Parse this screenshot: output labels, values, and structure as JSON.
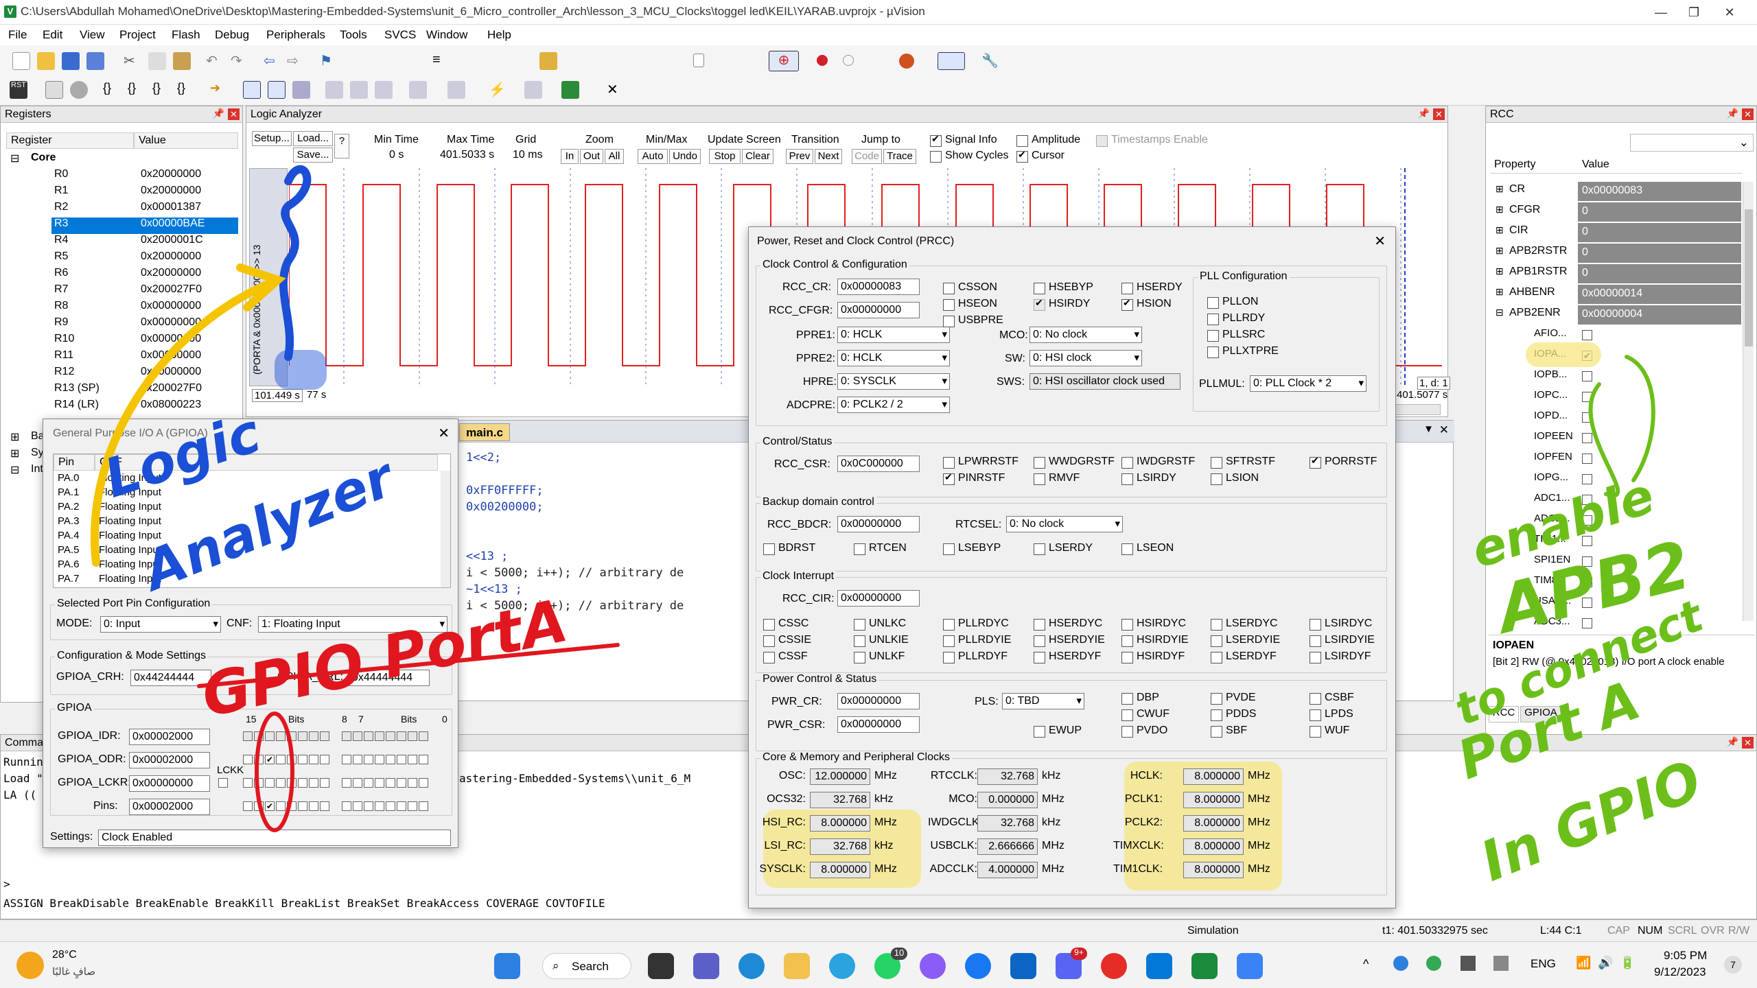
{
  "window": {
    "title": "C:\\Users\\Abdullah Mohamed\\OneDrive\\Desktop\\Mastering-Embedded-Systems\\unit_6_Micro_controller_Arch\\lesson_3_MCU_Clocks\\toggel led\\KEIL\\YARAB.uvprojx - µVision"
  },
  "menu": [
    "File",
    "Edit",
    "View",
    "Project",
    "Flash",
    "Debug",
    "Peripherals",
    "Tools",
    "SVCS",
    "Window",
    "Help"
  ],
  "registers": {
    "title": "Registers",
    "col_register": "Register",
    "col_value": "Value",
    "group": "Core",
    "rows": [
      {
        "name": "R0",
        "value": "0x20000000"
      },
      {
        "name": "R1",
        "value": "0x20000000"
      },
      {
        "name": "R2",
        "value": "0x00001387"
      },
      {
        "name": "R3",
        "value": "0x00000BAE"
      },
      {
        "name": "R4",
        "value": "0x2000001C"
      },
      {
        "name": "R5",
        "value": "0x20000000"
      },
      {
        "name": "R6",
        "value": "0x20000000"
      },
      {
        "name": "R7",
        "value": "0x200027F0"
      },
      {
        "name": "R8",
        "value": "0x00000000"
      },
      {
        "name": "R9",
        "value": "0x00000000"
      },
      {
        "name": "R10",
        "value": "0x00000000"
      },
      {
        "name": "R11",
        "value": "0x00000000"
      },
      {
        "name": "R12",
        "value": "0x00000000"
      },
      {
        "name": "R13 (SP)",
        "value": "0x200027F0"
      },
      {
        "name": "R14 (LR)",
        "value": "0x08000223"
      }
    ],
    "tree_more": [
      "Ba",
      "Sy",
      "Int"
    ]
  },
  "logic_analyzer": {
    "title": "Logic Analyzer",
    "setup": "Setup...",
    "load": "Load...",
    "save": "Save...",
    "help": "?",
    "min_time_label": "Min Time",
    "min_time": "0 s",
    "max_time_label": "Max Time",
    "max_time": "401.5033 s",
    "grid_label": "Grid",
    "grid": "10 ms",
    "zoom_label": "Zoom",
    "zoom_in": "In",
    "zoom_out": "Out",
    "zoom_all": "All",
    "minmax_label": "Min/Max",
    "auto": "Auto",
    "undo": "Undo",
    "update_label": "Update Screen",
    "stop": "Stop",
    "clear": "Clear",
    "transition_label": "Transition",
    "prev": "Prev",
    "next": "Next",
    "jump_label": "Jump to",
    "code": "Code",
    "trace": "Trace",
    "signal_info": "Signal Info",
    "show_cycles": "Show Cycles",
    "amplitude": "Amplitude",
    "cursor": "Cursor",
    "timestamps": "Timestamps Enable",
    "signal_name": "(PORTA & 0x00002000) >> 13",
    "y_high": "1",
    "y_low": "0",
    "t_left": "101.449 s",
    "t_left2": "77 s",
    "t_right": "401.5077 s",
    "t_right2": "4 s",
    "cursor_val": "1, d: 1",
    "pulse_count": 15
  },
  "rcc_panel": {
    "title": "RCC",
    "col_property": "Property",
    "col_value": "Value",
    "rows": [
      {
        "name": "CR",
        "value": "0x00000083"
      },
      {
        "name": "CFGR",
        "value": "0"
      },
      {
        "name": "CIR",
        "value": "0"
      },
      {
        "name": "APB2RSTR",
        "value": "0"
      },
      {
        "name": "APB1RSTR",
        "value": "0"
      },
      {
        "name": "AHBENR",
        "value": "0x00000014"
      },
      {
        "name": "APB2ENR",
        "value": "0x00000004"
      }
    ],
    "bits": [
      {
        "name": "AFIO...",
        "checked": false
      },
      {
        "name": "IOPA...",
        "checked": true
      },
      {
        "name": "IOPB...",
        "checked": false
      },
      {
        "name": "IOPC...",
        "checked": false
      },
      {
        "name": "IOPD...",
        "checked": false
      },
      {
        "name": "IOPEEN",
        "checked": false
      },
      {
        "name": "IOPFEN",
        "checked": false
      },
      {
        "name": "IOPG...",
        "checked": false
      },
      {
        "name": "ADC1...",
        "checked": false
      },
      {
        "name": "ADC2...",
        "checked": false
      },
      {
        "name": "TIM1...",
        "checked": false
      },
      {
        "name": "SPI1EN",
        "checked": false
      },
      {
        "name": "TIM8...",
        "checked": false
      },
      {
        "name": "USAR...",
        "checked": false
      },
      {
        "name": "ADC3...",
        "checked": false
      }
    ],
    "desc_title": "IOPAEN",
    "desc_text": "[Bit 2] RW (@ 0x40021018) I/O port A clock enable",
    "tabs": [
      "RCC",
      "GPIOA"
    ]
  },
  "gpio": {
    "title": "General Purpose I/O A (GPIOA)",
    "col_pin": "Pin",
    "col_cnf": "CNF",
    "pins": [
      {
        "pin": "PA.0",
        "cnf": "Floating Input"
      },
      {
        "pin": "PA.1",
        "cnf": "Floating Input"
      },
      {
        "pin": "PA.2",
        "cnf": "Floating Input"
      },
      {
        "pin": "PA.3",
        "cnf": "Floating Input"
      },
      {
        "pin": "PA.4",
        "cnf": "Floating Input"
      },
      {
        "pin": "PA.5",
        "cnf": "Floating Input"
      },
      {
        "pin": "PA.6",
        "cnf": "Floating Input"
      },
      {
        "pin": "PA.7",
        "cnf": "Floating Input"
      }
    ],
    "sel_port_group": "Selected Port Pin Configuration",
    "mode_label": "MODE:",
    "mode": "0: Input",
    "cnf_label": "CNF:",
    "cnf": "1: Floating Input",
    "cfg_group": "Configuration & Mode Settings",
    "crh_label": "GPIOA_CRH:",
    "crh": "0x44244444",
    "crl_label": "GPIOA_CRL:",
    "crl": "0x44444444",
    "gpioa_group": "GPIOA",
    "bits_hi": "15",
    "bits_label": "Bits",
    "bits_8": "8",
    "bits_7": "7",
    "bits_0": "0",
    "idr_label": "GPIOA_IDR:",
    "idr": "0x00002000",
    "odr_label": "GPIOA_ODR:",
    "odr": "0x00002000",
    "lckr_label": "GPIOA_LCKR:",
    "lckr": "0x00000000",
    "lckk": "LCKK",
    "pins_label": "Pins:",
    "pins_val": "0x00002000",
    "settings_label": "Settings:",
    "settings": "Clock Enabled"
  },
  "editor": {
    "tab": "main.c",
    "lines": [
      " 1<<2;",
      "",
      "0xFF0FFFFF;",
      "0x00200000;",
      "",
      "",
      "<<13 ;",
      "i < 5000; i++); // arbitrary de",
      "~1<<13 ;",
      "i < 5000; i++); // arbitrary de"
    ]
  },
  "command": {
    "title": "Command",
    "lines": [
      "Running",
      "Load \"",
      "LA ((",
      "",
      "astering-Embedded-Systems\\\\unit_6_M"
    ],
    "prompt": ">",
    "help": "ASSIGN BreakDisable BreakEnable BreakKill BreakList BreakSet BreakAccess COVERAGE COVTOFILE"
  },
  "prcc": {
    "title": "Power, Reset and Clock Control (PRCC)",
    "clk_group": "Clock Control & Configuration",
    "rcc_cr_label": "RCC_CR:",
    "rcc_cr": "0x00000083",
    "rcc_cfgr_label": "RCC_CFGR:",
    "rcc_cfgr": "0x00000000",
    "ppre1_label": "PPRE1:",
    "ppre1": "0: HCLK",
    "ppre2_label": "PPRE2:",
    "ppre2": "0: HCLK",
    "hpre_label": "HPRE:",
    "hpre": "0: SYSCLK",
    "adcpre_label": "ADCPRE:",
    "adcpre": "0: PCLK2 / 2",
    "mco_label": "MCO:",
    "mco": "0: No clock",
    "sw_label": "SW:",
    "sw": "0: HSI clock",
    "sws_label": "SWS:",
    "sws": "0: HSI oscillator clock used",
    "cr_bits": [
      {
        "name": "CSSON",
        "checked": false
      },
      {
        "name": "HSEBYP",
        "checked": false
      },
      {
        "name": "HSERDY",
        "checked": false
      },
      {
        "name": "HSEON",
        "checked": false
      },
      {
        "name": "HSIRDY",
        "checked": true
      },
      {
        "name": "HSION",
        "checked": true
      },
      {
        "name": "USBPRE",
        "checked": false
      }
    ],
    "pll_group": "PLL Configuration",
    "pll_bits": [
      "PLLON",
      "PLLRDY",
      "PLLSRC",
      "PLLXTPRE"
    ],
    "pllmul_label": "PLLMUL:",
    "pllmul": "0: PLL Clock * 2",
    "cs_group": "Control/Status",
    "rcc_csr_label": "RCC_CSR:",
    "rcc_csr": "0x0C000000",
    "csr_bits": [
      {
        "name": "LPWRRSTF",
        "checked": false
      },
      {
        "name": "WWDGRSTF",
        "checked": false
      },
      {
        "name": "IWDGRSTF",
        "checked": false
      },
      {
        "name": "SFTRSTF",
        "checked": false
      },
      {
        "name": "PORRSTF",
        "checked": true
      },
      {
        "name": "PINRSTF",
        "checked": true
      },
      {
        "name": "RMVF",
        "checked": false
      },
      {
        "name": "LSIRDY",
        "checked": false
      },
      {
        "name": "LSION",
        "checked": false
      }
    ],
    "bd_group": "Backup domain control",
    "rcc_bdcr_label": "RCC_BDCR:",
    "rcc_bdcr": "0x00000000",
    "rtcsel_label": "RTCSEL:",
    "rtcsel": "0: No clock",
    "bd_bits": [
      "BDRST",
      "RTCEN",
      "LSEBYP",
      "LSERDY",
      "LSEON"
    ],
    "ci_group": "Clock Interrupt",
    "rcc_cir_label": "RCC_CIR:",
    "rcc_cir": "0x00000000",
    "cir_bits": [
      "CSSC",
      "UNLKC",
      "PLLRDYC",
      "HSERDYC",
      "HSIRDYC",
      "LSERDYC",
      "LSIRDYC",
      "CSSIE",
      "UNLKIE",
      "PLLRDYIE",
      "HSERDYIE",
      "HSIRDYIE",
      "LSERDYIE",
      "LSIRDYIE",
      "CSSF",
      "UNLKF",
      "PLLRDYF",
      "HSERDYF",
      "HSIRDYF",
      "LSERDYF",
      "LSIRDYF"
    ],
    "pc_group": "Power Control & Status",
    "pwr_cr_label": "PWR_CR:",
    "pwr_cr": "0x00000000",
    "pwr_csr_label": "PWR_CSR:",
    "pwr_csr": "0x00000000",
    "pls_label": "PLS:",
    "pls": "0: TBD",
    "pwr_bits": [
      "DBP",
      "PVDE",
      "CSBF",
      "CWUF",
      "PDDS",
      "LPDS",
      "EWUP",
      "PVDO",
      "SBF",
      "WUF"
    ],
    "core_group": "Core & Memory and Peripheral Clocks",
    "osc_label": "OSC:",
    "osc": "12.000000",
    "osc_unit": "MHz",
    "ocs32_label": "OCS32:",
    "ocs32": "32.768",
    "ocs32_unit": "kHz",
    "hsi_rc_label": "HSI_RC:",
    "hsi_rc": "8.000000",
    "hsi_rc_unit": "MHz",
    "lsi_rc_label": "LSI_RC:",
    "lsi_rc": "32.768",
    "lsi_rc_unit": "kHz",
    "sysclk_label": "SYSCLK:",
    "sysclk": "8.000000",
    "sysclk_unit": "MHz",
    "rtcclk_label": "RTCCLK:",
    "rtcclk": "32.768",
    "rtcclk_unit": "kHz",
    "mco_clk_label": "MCO:",
    "mco_clk": "0.000000",
    "mco_clk_unit": "MHz",
    "iwdgclk_label": "IWDGCLK:",
    "iwdgclk": "32.768",
    "iwdgclk_unit": "kHz",
    "usbclk_label": "USBCLK:",
    "usbclk": "2.666666",
    "usbclk_unit": "MHz",
    "adcclk_label": "ADCCLK:",
    "adcclk": "4.000000",
    "adcclk_unit": "MHz",
    "hclk_label": "HCLK:",
    "hclk": "8.000000",
    "hclk_unit": "MHz",
    "pclk1_label": "PCLK1:",
    "pclk1": "8.000000",
    "pclk1_unit": "MHz",
    "pclk2_label": "PCLK2:",
    "pclk2": "8.000000",
    "pclk2_unit": "MHz",
    "timxclk_label": "TIMXCLK:",
    "timxclk": "8.000000",
    "timxclk_unit": "MHz",
    "tim1clk_label": "TIM1CLK:",
    "tim1clk": "8.000000",
    "tim1clk_unit": "MHz"
  },
  "annotations": {
    "logic": "Logic",
    "analyzer": "Analyzer",
    "gpio_port_a": "GPIO PortA",
    "enable": "enable",
    "apb2": "APB2",
    "to_connect": "to connect",
    "port_a": "Port A",
    "in_gpio": "In GPIO"
  },
  "statusbar": {
    "mode": "Simulation",
    "time": "t1: 401.50332975 sec",
    "pos": "L:44 C:1",
    "caps": "CAP",
    "num": "NUM",
    "scrl": "SCRL",
    "ovr": "OVR",
    "rw": "R/W"
  },
  "taskbar": {
    "temp": "28°C",
    "weather": "صافٍ غالبًا",
    "search": "Search",
    "lang": "ENG",
    "time": "9:05 PM",
    "date": "9/12/2023",
    "badge_whatsapp": "10",
    "badge_discord": "9+",
    "notif": "7"
  },
  "colors": {
    "accent": "#0078d7",
    "signal": "#e02020",
    "ink_blue": "#1a4fd6",
    "ink_red": "#e0171f",
    "ink_green": "#6cbf1a",
    "ink_yellow": "#f5c400",
    "highlight": "#f5e680"
  }
}
